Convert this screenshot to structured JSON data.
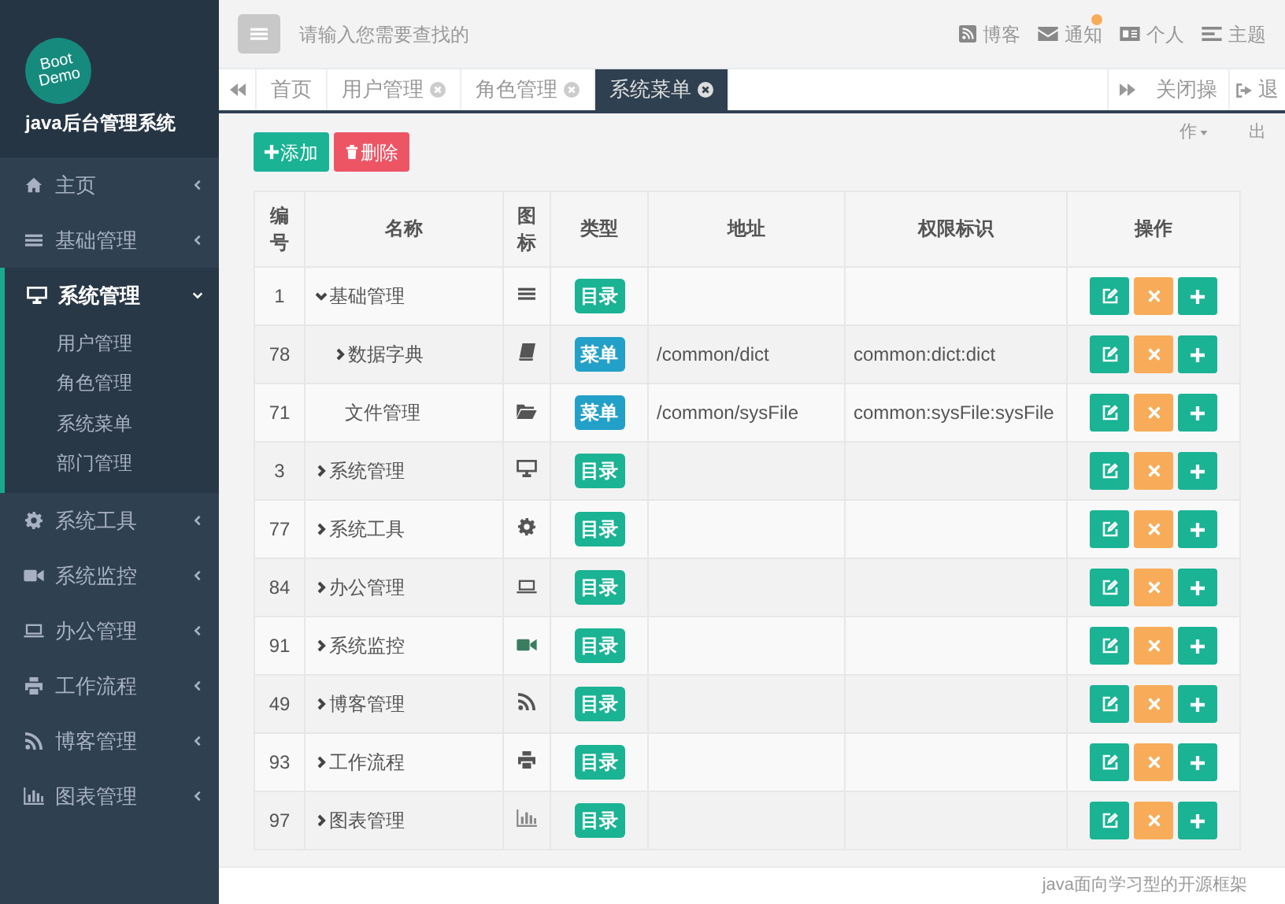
{
  "sidebar": {
    "logo": {
      "line_1": "Boot",
      "line_2": "Demo"
    },
    "app_title": "java后台管理系统",
    "items": [
      {
        "label": "主页",
        "expanded": false
      },
      {
        "label": "基础管理",
        "expanded": false
      },
      {
        "label": "系统管理",
        "expanded": true,
        "children": [
          {
            "label": "用户管理"
          },
          {
            "label": "角色管理"
          },
          {
            "label": "系统菜单"
          },
          {
            "label": "部门管理"
          }
        ]
      },
      {
        "label": "系统工具",
        "expanded": false
      },
      {
        "label": "系统监控",
        "expanded": false
      },
      {
        "label": "办公管理",
        "expanded": false
      },
      {
        "label": "工作流程",
        "expanded": false
      },
      {
        "label": "博客管理",
        "expanded": false
      },
      {
        "label": "图表管理",
        "expanded": false
      }
    ]
  },
  "header": {
    "search": {
      "placeholder": "请输入您需要查找的"
    },
    "links": [
      {
        "label": "博客"
      },
      {
        "label": "通知"
      },
      {
        "label": "个人"
      },
      {
        "label": "主题"
      }
    ]
  },
  "tabs": [
    {
      "label": "首页",
      "closable": false,
      "selected": false
    },
    {
      "label": "用户管理",
      "closable": true,
      "selected": false
    },
    {
      "label": "角色管理",
      "closable": true,
      "selected": false
    },
    {
      "label": "系统菜单",
      "closable": true,
      "selected": true
    }
  ],
  "tab_actions": {
    "close_label": "关闭操",
    "logout_label": "退"
  },
  "toolbar": {
    "add": "添加",
    "delete": "删除",
    "column_menu": "作",
    "export": "出"
  },
  "table": {
    "columns": [
      "编号",
      "名称",
      "图标",
      "类型",
      "地址",
      "权限标识",
      "操作"
    ],
    "rows": [
      {
        "id": "1",
        "name": "基础管理",
        "kind": "directory",
        "type": "目录",
        "expanded": true,
        "children": [
          {
            "id": "78",
            "name": "数据字典",
            "kind": "menu",
            "type": "菜单",
            "url": "/common/dict",
            "permission": "common:dict:dict",
            "expanded": false,
            "has_children": true
          },
          {
            "id": "71",
            "name": "文件管理",
            "kind": "menu",
            "type": "菜单",
            "url": "/common/sysFile",
            "permission": "common:sysFile:sysFile",
            "has_children": false
          }
        ]
      },
      {
        "id": "3",
        "name": "系统管理",
        "kind": "directory",
        "type": "目录",
        "expanded": false,
        "has_children": true
      },
      {
        "id": "77",
        "name": "系统工具",
        "kind": "directory",
        "type": "目录",
        "expanded": false,
        "has_children": true
      },
      {
        "id": "84",
        "name": "办公管理",
        "kind": "directory",
        "type": "目录",
        "expanded": false,
        "has_children": true
      },
      {
        "id": "91",
        "name": "系统监控",
        "kind": "directory",
        "type": "目录",
        "expanded": false,
        "has_children": true
      },
      {
        "id": "49",
        "name": "博客管理",
        "kind": "directory",
        "type": "目录",
        "expanded": false,
        "has_children": true
      },
      {
        "id": "93",
        "name": "工作流程",
        "kind": "directory",
        "type": "目录",
        "expanded": false,
        "has_children": true
      },
      {
        "id": "97",
        "name": "图表管理",
        "kind": "directory",
        "type": "目录",
        "expanded": false,
        "has_children": true
      }
    ]
  },
  "footer": "java面向学习型的开源框架"
}
